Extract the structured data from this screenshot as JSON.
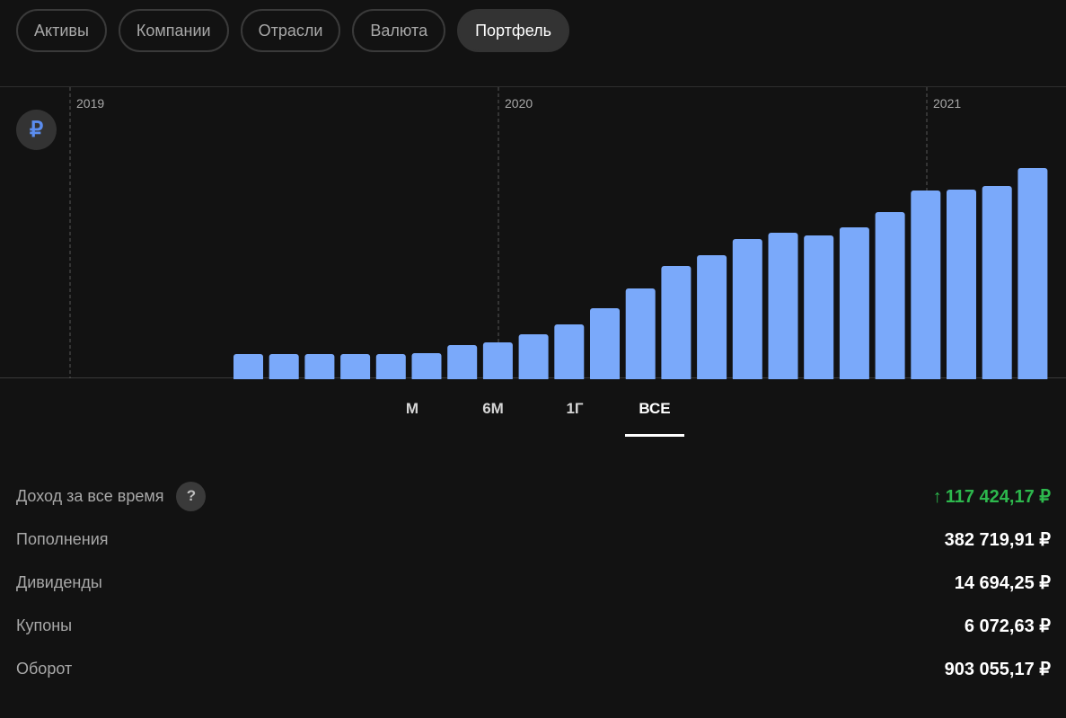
{
  "tabs": [
    {
      "label": "Активы",
      "active": false
    },
    {
      "label": "Компании",
      "active": false
    },
    {
      "label": "Отрасли",
      "active": false
    },
    {
      "label": "Валюта",
      "active": false
    },
    {
      "label": "Портфель",
      "active": true
    }
  ],
  "currency": {
    "symbol": "₽",
    "icon": "ruble-icon"
  },
  "chart_data": {
    "type": "bar",
    "year_labels": [
      "2019",
      "2020",
      "2021"
    ],
    "values": [
      27,
      27,
      27,
      27,
      27,
      28,
      37,
      40,
      49,
      60,
      78,
      100,
      125,
      137,
      155,
      162,
      159,
      168,
      185,
      209,
      210,
      214,
      234
    ],
    "ylim": [
      0,
      234
    ],
    "grid": false,
    "bar_color": "#7aa9fa"
  },
  "periods": [
    {
      "label": "М",
      "active": false
    },
    {
      "label": "6М",
      "active": false
    },
    {
      "label": "1Г",
      "active": false
    },
    {
      "label": "ВСЕ",
      "active": true
    }
  ],
  "stats": {
    "income": {
      "label": "Доход за все время",
      "help": "?",
      "arrow": "↑",
      "value": "117 424,17 ₽",
      "color": "#2db84d"
    },
    "deposits": {
      "label": "Пополнения",
      "value": "382 719,91 ₽"
    },
    "dividends": {
      "label": "Дивиденды",
      "value": "14 694,25 ₽"
    },
    "coupons": {
      "label": "Купоны",
      "value": "6 072,63 ₽"
    },
    "turnover": {
      "label": "Оборот",
      "value": "903 055,17 ₽"
    }
  }
}
